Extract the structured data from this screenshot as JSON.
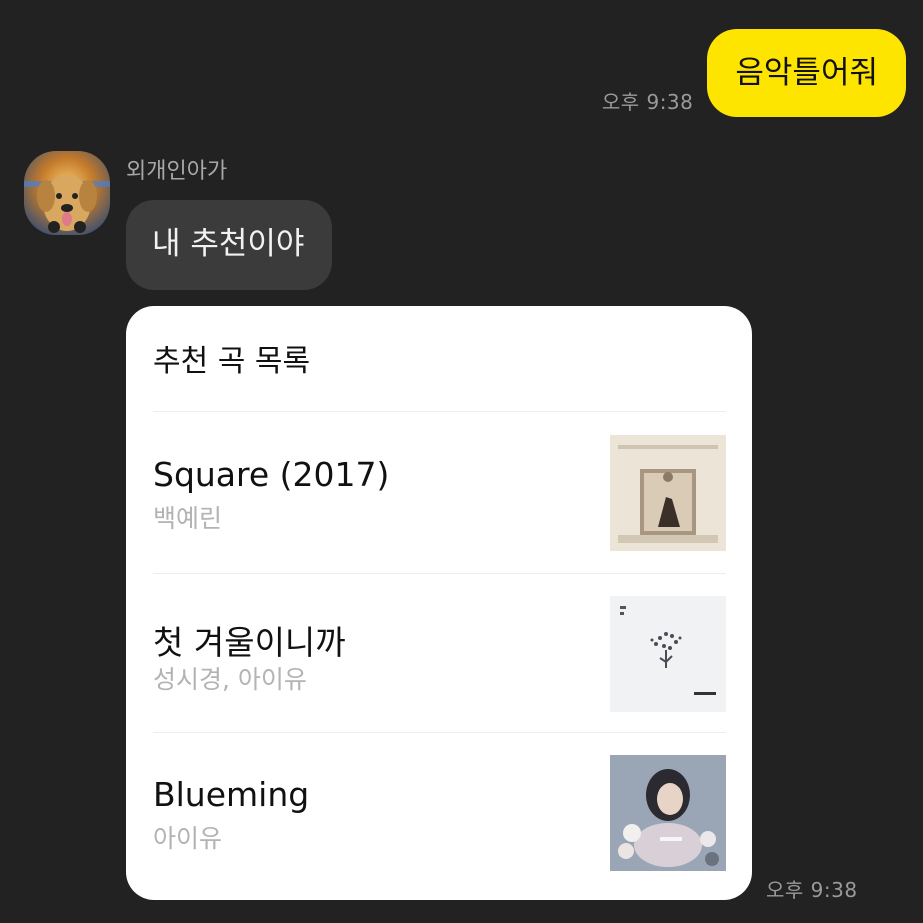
{
  "outgoing": {
    "text": "음악틀어줘",
    "time": "오후 9:38",
    "bubble_color": "#fee500"
  },
  "incoming": {
    "sender": "외개인아가",
    "avatar_icon": "dog-avatar",
    "text": "내 추천이야",
    "time": "오후 9:38"
  },
  "card": {
    "title": "추천 곡 목록",
    "songs": [
      {
        "title": "Square (2017)",
        "artist": "백예린",
        "cover_icon": "album-cover-square"
      },
      {
        "title": "첫 겨울이니까",
        "artist": "성시경, 아이유",
        "cover_icon": "album-cover-first-winter"
      },
      {
        "title": "Blueming",
        "artist": "아이유",
        "cover_icon": "album-cover-love-poem"
      }
    ]
  }
}
